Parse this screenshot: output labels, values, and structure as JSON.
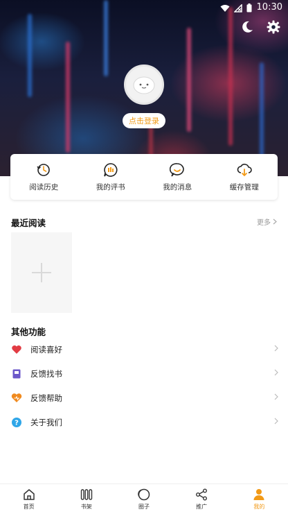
{
  "status_bar": {
    "time": "10:30"
  },
  "header": {
    "login_label": "点击登录"
  },
  "quick_actions": [
    {
      "label": "阅读历史",
      "icon": "history-icon"
    },
    {
      "label": "我的评书",
      "icon": "review-icon"
    },
    {
      "label": "我的消息",
      "icon": "message-icon"
    },
    {
      "label": "缓存管理",
      "icon": "cache-download-icon"
    }
  ],
  "recent": {
    "title": "最近阅读",
    "more_label": "更多"
  },
  "functions": {
    "title": "其他功能",
    "items": [
      {
        "label": "阅读喜好",
        "icon": "heart-icon",
        "color": "#e23c44"
      },
      {
        "label": "反馈找书",
        "icon": "book-icon",
        "color": "#6b57c9"
      },
      {
        "label": "反馈帮助",
        "icon": "help-heart-icon",
        "color": "#f08a1e"
      },
      {
        "label": "关于我们",
        "icon": "question-icon",
        "color": "#2fa6e8"
      }
    ]
  },
  "bottom_nav": [
    {
      "label": "首页",
      "icon": "home-icon"
    },
    {
      "label": "书架",
      "icon": "bookshelf-icon"
    },
    {
      "label": "圈子",
      "icon": "circle-icon"
    },
    {
      "label": "推广",
      "icon": "share-icon"
    },
    {
      "label": "我的",
      "icon": "profile-icon",
      "active": true
    }
  ],
  "colors": {
    "accent": "#f29a17"
  }
}
